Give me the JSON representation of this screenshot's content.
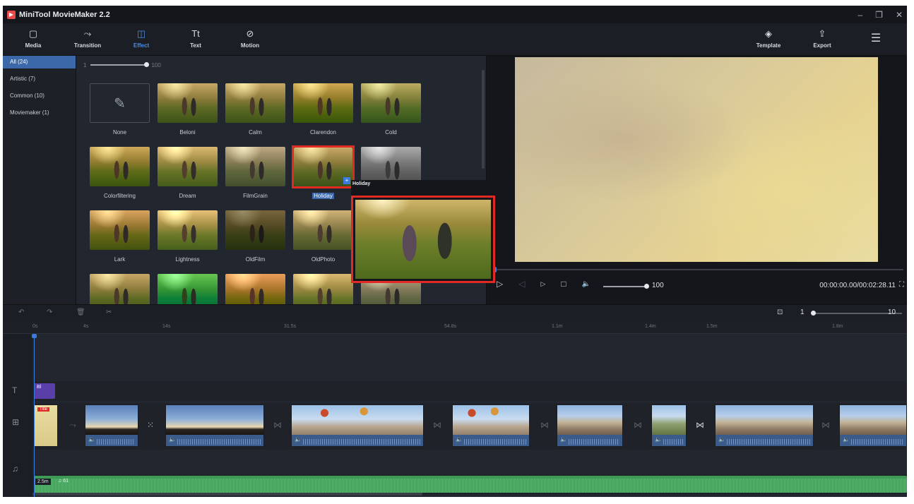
{
  "window": {
    "title": "MiniTool MovieMaker 2.2",
    "minimize": "–",
    "maximize": "❐",
    "close": "✕"
  },
  "toolbar": {
    "items": [
      {
        "label": "Media",
        "icon": "▢"
      },
      {
        "label": "Transition",
        "icon": "⤳"
      },
      {
        "label": "Effect",
        "icon": "◫"
      },
      {
        "label": "Text",
        "icon": "Tt"
      },
      {
        "label": "Motion",
        "icon": "⊘"
      }
    ],
    "active": "Effect",
    "template_label": "Template",
    "template_icon": "◈",
    "export_label": "Export",
    "export_icon": "⇪",
    "menu_icon": "☰"
  },
  "sidebar": {
    "categories": [
      "All (24)",
      "Artistic (7)",
      "Common (10)",
      "Moviemaker (1)"
    ],
    "active": "All (24)"
  },
  "effects": {
    "intensity_min": "1",
    "intensity_max": "100",
    "intensity_value": 100,
    "tiles": [
      "None",
      "Beloni",
      "Calm",
      "Clarendon",
      "Cold",
      "Colorfiltering",
      "Dream",
      "FilmGrain",
      "Holiday",
      "",
      "Lark",
      "Lightness",
      "OldFilm",
      "OldPhoto",
      "",
      "",
      "",
      "",
      "",
      ""
    ],
    "selected": "Holiday",
    "preview_title": "Holiday",
    "apply_badge": "+"
  },
  "player": {
    "volume": "100",
    "volume_level": 1.0,
    "time": "00:00:00.00/00:02:28.11",
    "play_icon": "▷",
    "prev_icon": "◁",
    "next_icon": "▷",
    "stop_icon": "□",
    "volume_icon": "🔈",
    "fullscreen_icon": "⛶"
  },
  "timeline_tools": {
    "undo": "↶",
    "redo": "↷",
    "delete": "🗑",
    "split": "✂",
    "zoom_fit": "⊡",
    "zoom_min": "1",
    "zoom_max": "10"
  },
  "ruler": [
    "0s",
    "4s",
    "14s",
    "31.5s",
    "54.8s",
    "1.1m",
    "1.4m",
    "1.5m",
    "1.8m"
  ],
  "tracks": {
    "text_icon": "T",
    "video_icon": "⊞",
    "music_icon": "♫",
    "text_clip": "Bl",
    "title_badge": "Title",
    "speaker": "🔈",
    "transition_icons": [
      "⤳",
      "⁙",
      "⋈",
      "⋈",
      "⋈",
      "⋈",
      "⋈",
      "⋈"
    ],
    "music_length": "2.5m",
    "music_name": "♫ 61"
  }
}
